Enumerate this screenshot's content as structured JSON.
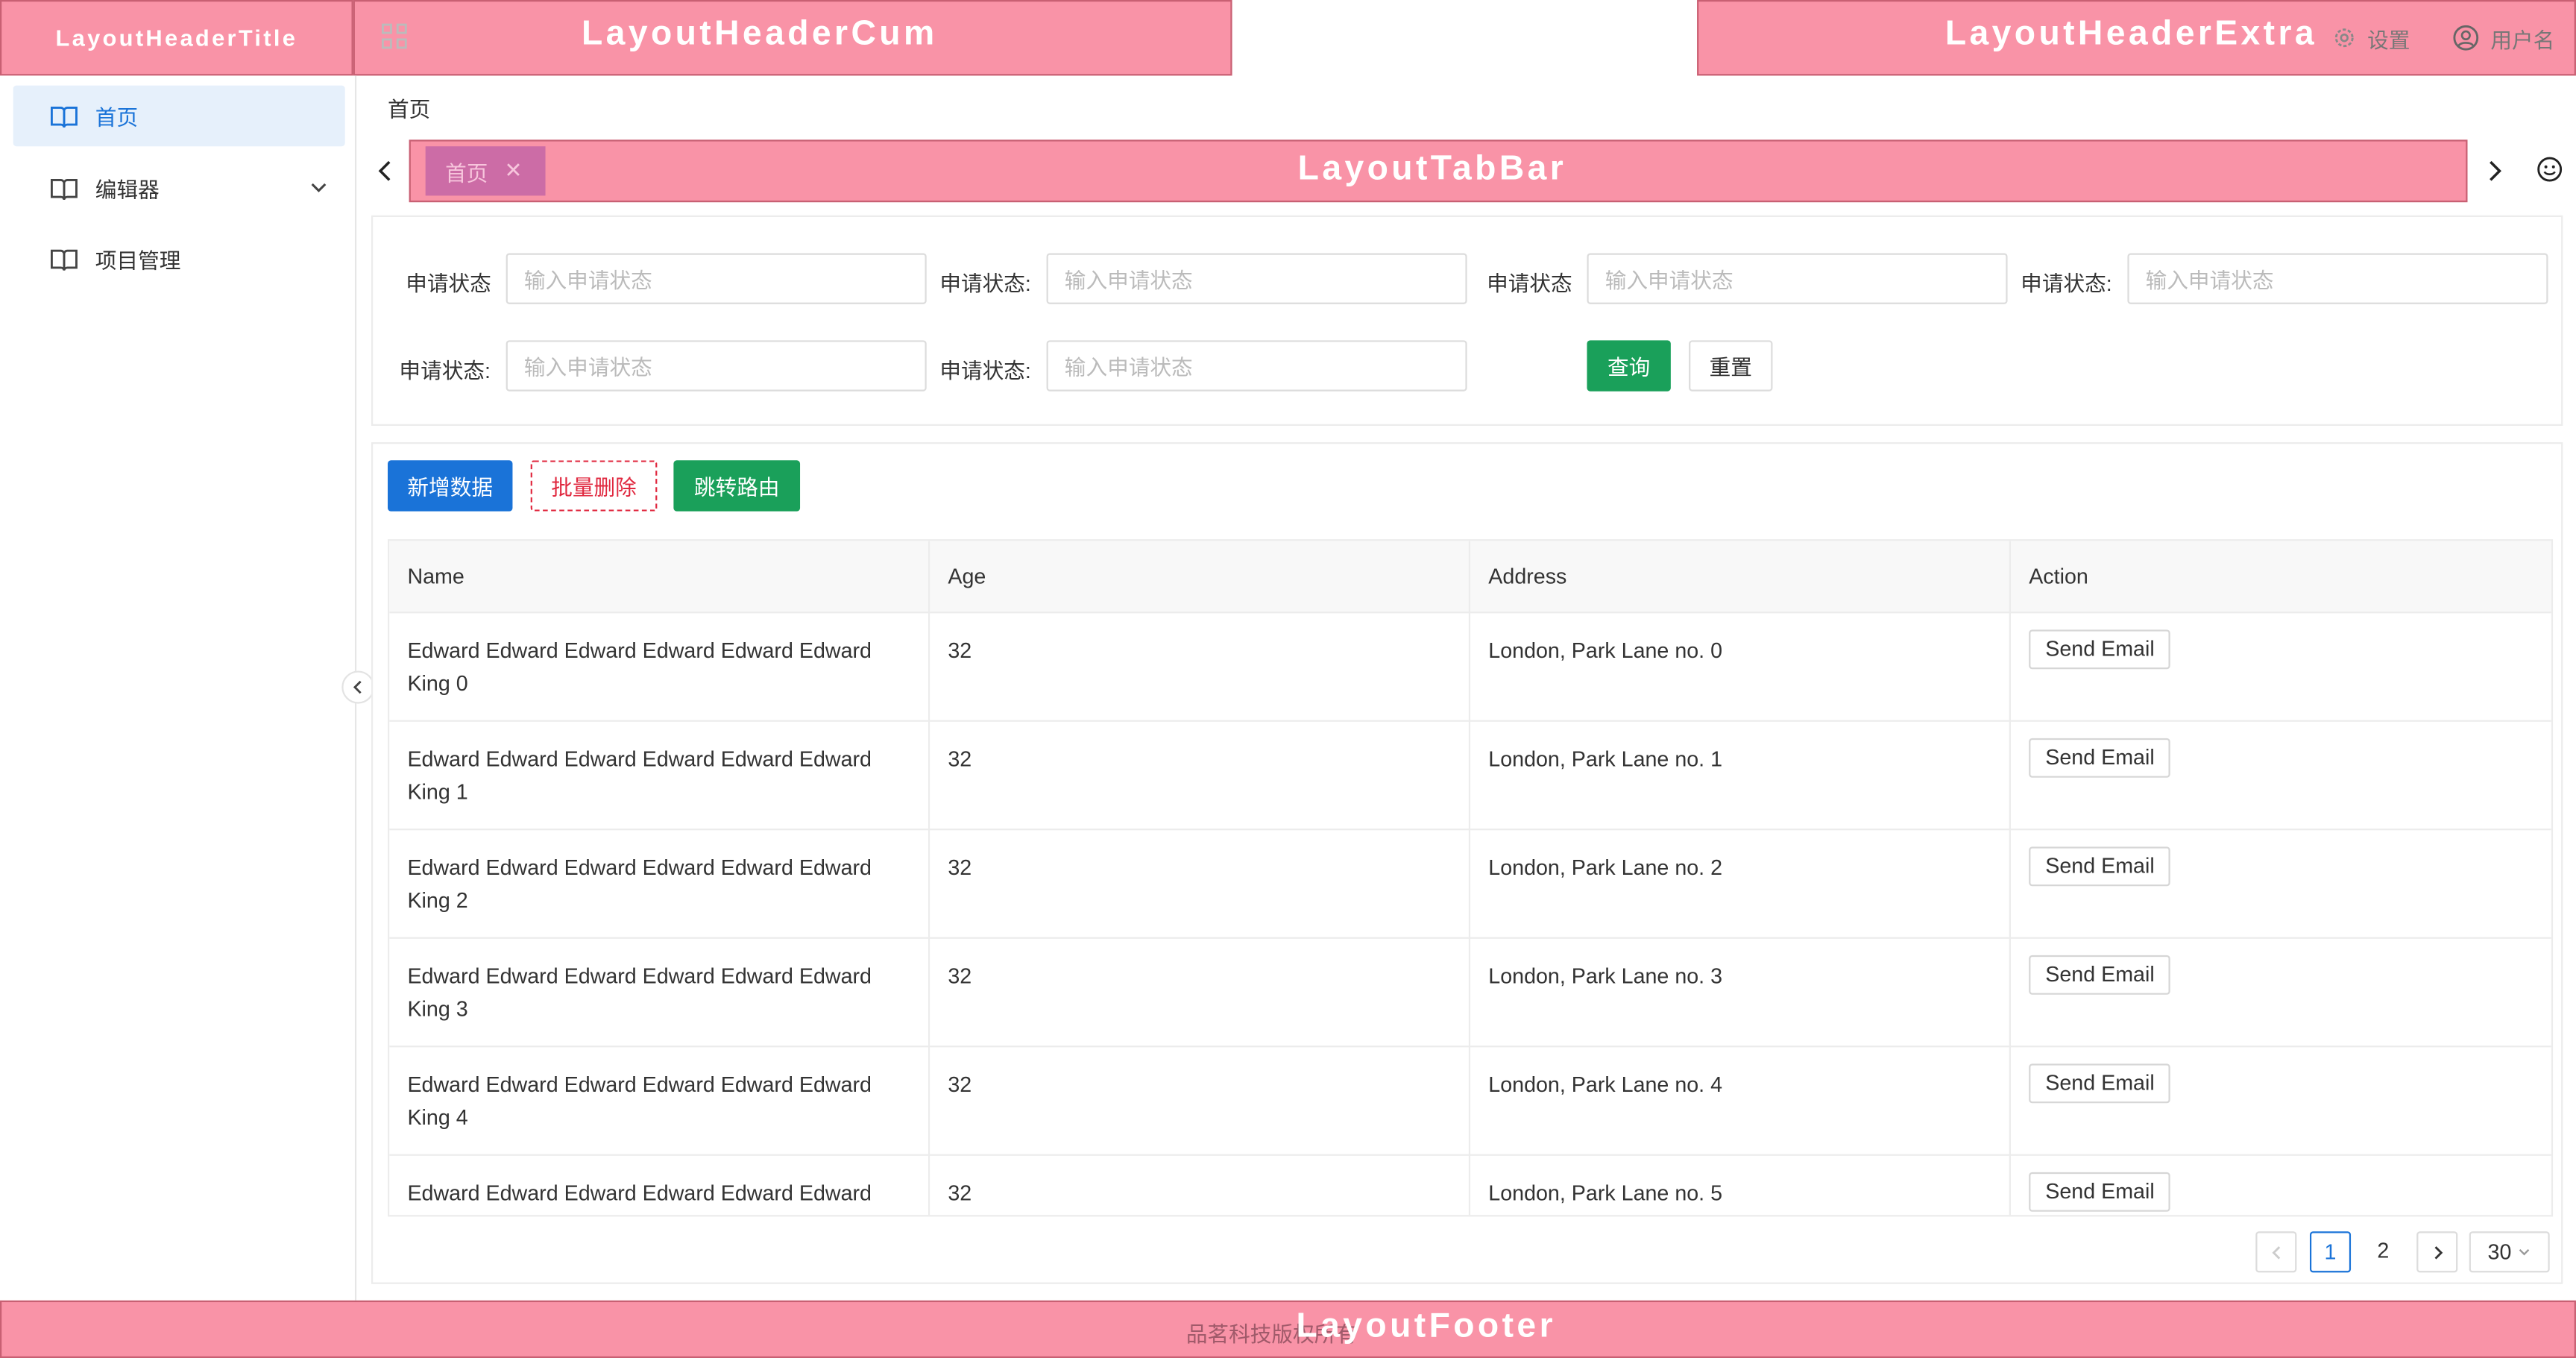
{
  "header": {
    "title_label": "LayoutHeaderTitle",
    "cum_label": "LayoutHeaderCum",
    "extra_label": "LayoutHeaderExtra",
    "settings_label": "设置",
    "user_label": "用户名"
  },
  "sidebar": {
    "items": [
      {
        "label": "首页",
        "icon": "book-icon",
        "active": true
      },
      {
        "label": "编辑器",
        "icon": "book-icon",
        "has_children": true
      },
      {
        "label": "项目管理",
        "icon": "book-icon"
      }
    ]
  },
  "breadcrumb": {
    "current": "首页"
  },
  "tabbar": {
    "label": "LayoutTabBar",
    "tabs": [
      {
        "label": "首页",
        "close": "✕"
      }
    ]
  },
  "search": {
    "fields": [
      {
        "label": "申请状态",
        "placeholder": "输入申请状态"
      },
      {
        "label": "申请状态:",
        "placeholder": "输入申请状态"
      },
      {
        "label": "申请状态",
        "placeholder": "输入申请状态"
      },
      {
        "label": "申请状态:",
        "placeholder": "输入申请状态"
      },
      {
        "label": "申请状态:",
        "placeholder": "输入申请状态"
      },
      {
        "label": "申请状态:",
        "placeholder": "输入申请状态"
      }
    ],
    "query_label": "查询",
    "reset_label": "重置"
  },
  "toolbar": {
    "add_label": "新增数据",
    "batch_delete_label": "批量删除",
    "route_label": "跳转路由"
  },
  "table": {
    "columns": [
      "Name",
      "Age",
      "Address",
      "Action"
    ],
    "rows": [
      {
        "name": "Edward Edward Edward Edward Edward Edward King 0",
        "age": "32",
        "address": "London, Park Lane no. 0",
        "action": "Send Email"
      },
      {
        "name": "Edward Edward Edward Edward Edward Edward King 1",
        "age": "32",
        "address": "London, Park Lane no. 1",
        "action": "Send Email"
      },
      {
        "name": "Edward Edward Edward Edward Edward Edward King 2",
        "age": "32",
        "address": "London, Park Lane no. 2",
        "action": "Send Email"
      },
      {
        "name": "Edward Edward Edward Edward Edward Edward King 3",
        "age": "32",
        "address": "London, Park Lane no. 3",
        "action": "Send Email"
      },
      {
        "name": "Edward Edward Edward Edward Edward Edward King 4",
        "age": "32",
        "address": "London, Park Lane no. 4",
        "action": "Send Email"
      },
      {
        "name": "Edward Edward Edward Edward Edward Edward King",
        "age": "32",
        "address": "London, Park Lane no. 5",
        "action": "Send Email"
      }
    ]
  },
  "pagination": {
    "pages": [
      "1",
      "2"
    ],
    "current": "1",
    "page_size": "30"
  },
  "footer": {
    "label": "LayoutFooter",
    "copyright": "品茗科技版权所有"
  },
  "colors": {
    "layout_marker": "#f993a7",
    "primary": "#1a73d8",
    "success": "#1aa05a",
    "danger": "#e0283f"
  }
}
